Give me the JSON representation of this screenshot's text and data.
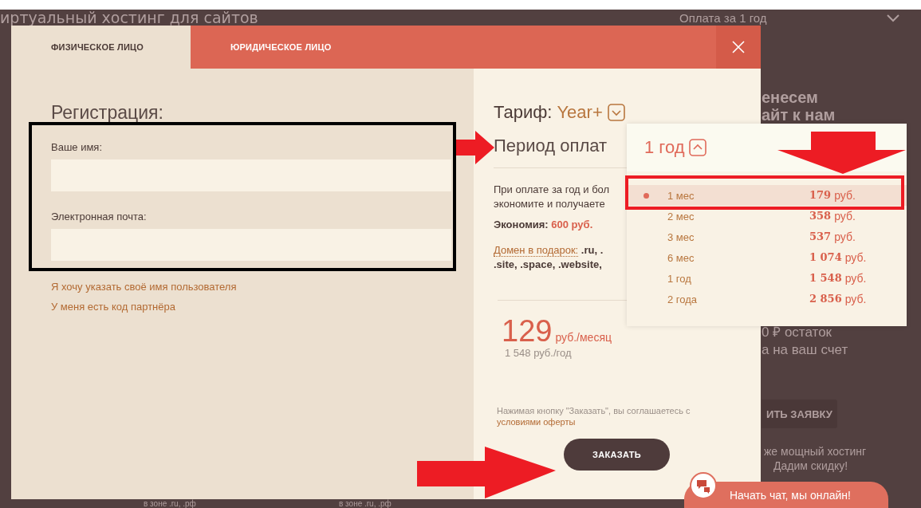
{
  "background_page": {
    "heading": "иртуальный хостинг для сайтов",
    "period_select": "Оплата за 1 год",
    "promo_lines": [
      "енесем",
      "айт к нам"
    ],
    "balance_lines": [
      "0 ₽ остаток",
      "а на ваш счет"
    ],
    "request_button": "ИТЬ ЗАЯВКУ",
    "note_lines": [
      "же мощный хостинг",
      "Дадим скидку!"
    ],
    "footer_cells": [
      "в зоне .ru, .рф",
      "в зоне .ru, .рф"
    ]
  },
  "modal": {
    "tabs": [
      {
        "label": "ФИЗИЧЕСКОЕ ЛИЦО",
        "selected": true
      },
      {
        "label": "ЮРИДИЧЕСКОЕ ЛИЦО",
        "selected": false
      }
    ],
    "registration": {
      "title": "Регистрация:",
      "fields": [
        {
          "label": "Ваше имя:"
        },
        {
          "label": "Электронная почта:"
        }
      ],
      "links": [
        "Я хочу указать своё имя пользователя",
        "У меня есть код партнёра"
      ]
    },
    "order": {
      "tariff_label": "Тариф:",
      "tariff": "Year+",
      "period_label": "Период оплат",
      "description_lines": [
        "При оплате за год и бол",
        "экономите и получаете"
      ],
      "savings_label": "Экономия:",
      "savings": "600 руб.",
      "gift_link": "Домен в подарок:",
      "gift_domain_lines": [
        ".ru, .",
        ".site, .space, .website,"
      ],
      "price": "129",
      "price_unit": "руб./месяц",
      "price_year": "1 548 руб./год",
      "terms": "Нажимая кнопку \"Заказать\", вы соглашаетесь с",
      "terms_link": "условиями оферты",
      "order_button": "ЗАКАЗАТЬ"
    }
  },
  "period_dropdown": {
    "current": "1 год",
    "expanded": true,
    "options": [
      {
        "period": "1 мес",
        "amount": "179",
        "currency": "руб.",
        "highlighted": true
      },
      {
        "period": "2 мес",
        "amount": "358",
        "currency": "руб.",
        "highlighted": false
      },
      {
        "period": "3 мес",
        "amount": "537",
        "currency": "руб.",
        "highlighted": false
      },
      {
        "period": "6 мес",
        "amount": "1 074",
        "currency": "руб.",
        "highlighted": false
      },
      {
        "period": "1 год",
        "amount": "1 548",
        "currency": "руб.",
        "highlighted": false
      },
      {
        "period": "2 года",
        "amount": "2 856",
        "currency": "руб.",
        "highlighted": false
      }
    ]
  },
  "chat": {
    "label": "Начать чат, мы онлайн!"
  }
}
